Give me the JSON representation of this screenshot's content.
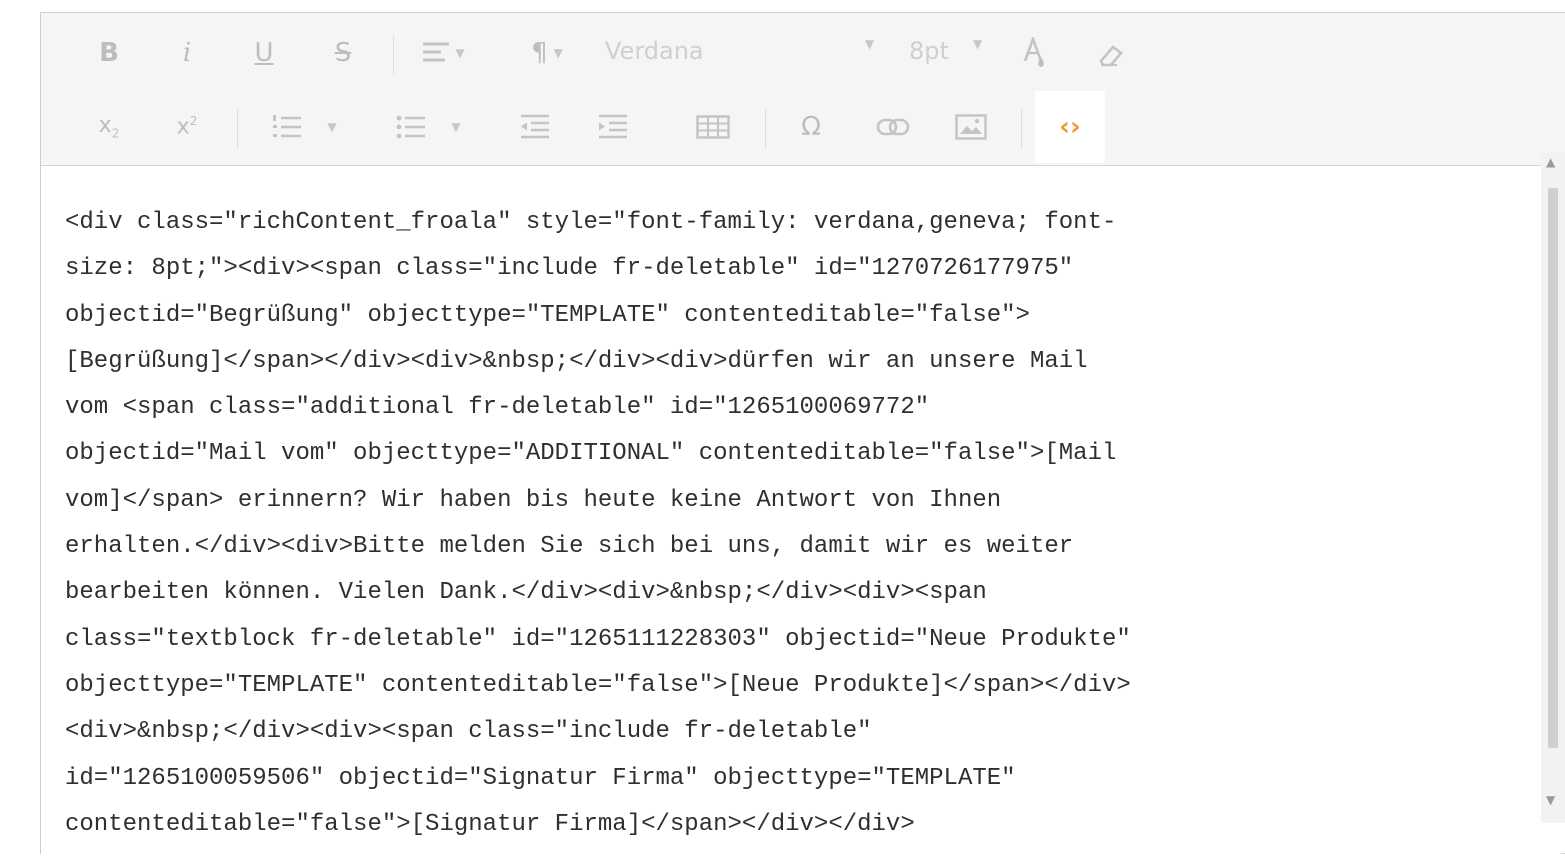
{
  "toolbar": {
    "row1": {
      "bold": "B",
      "italic": "i",
      "underline": "U",
      "strike": "S",
      "font_family": "Verdana",
      "font_size": "8pt"
    },
    "row2": {
      "subscript_base": "x",
      "subscript_mark": "2",
      "superscript_base": "x",
      "superscript_mark": "2",
      "special_chars": "Ω",
      "code_view": "‹›"
    }
  },
  "editor": {
    "code_lines": [
      "<div class=\"richContent_froala\" style=\"font-family: verdana,geneva; font-",
      "size: 8pt;\"><div><span class=\"include fr-deletable\" id=\"1270726177975\"",
      "objectid=\"Begrüßung\" objecttype=\"TEMPLATE\" contenteditable=\"false\">",
      "[Begrüßung]</span></div><div>&nbsp;</div><div>dürfen wir an unsere Mail",
      "vom <span class=\"additional fr-deletable\" id=\"1265100069772\"",
      "objectid=\"Mail vom\" objecttype=\"ADDITIONAL\" contenteditable=\"false\">[Mail",
      "vom]</span> erinnern? Wir haben bis heute keine Antwort von Ihnen",
      "erhalten.</div><div>Bitte melden Sie sich bei uns, damit wir es weiter",
      "bearbeiten können. Vielen Dank.</div><div>&nbsp;</div><div><span",
      "class=\"textblock fr-deletable\" id=\"1265111228303\" objectid=\"Neue Produkte\"",
      "objecttype=\"TEMPLATE\" contenteditable=\"false\">[Neue Produkte]</span></div>",
      "<div>&nbsp;</div><div><span class=\"include fr-deletable\"",
      "id=\"1265100059506\" objectid=\"Signatur Firma\" objecttype=\"TEMPLATE\"",
      "contenteditable=\"false\">[Signatur Firma]</span></div></div>"
    ]
  },
  "colors": {
    "toolbar_bg": "#f5f5f5",
    "icon_disabled": "#bdbdbd",
    "code_active": "#f29a2b",
    "text": "#2f2f2f"
  }
}
